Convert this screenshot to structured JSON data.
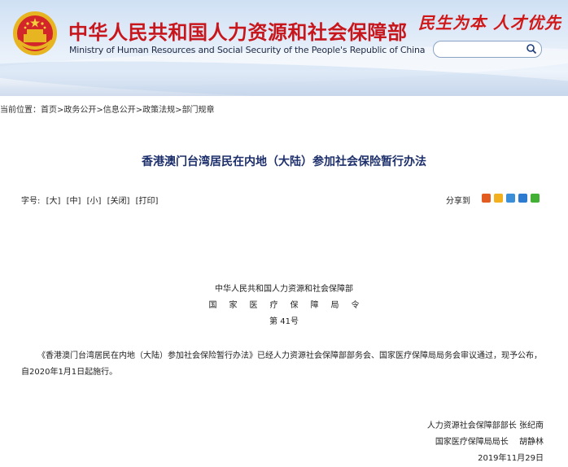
{
  "header": {
    "cn_title": "中华人民共和国人力资源和社会保障部",
    "en_title": "Ministry of Human Resources and Social Security of the People's Republic of China",
    "slogan": "民生为本 人才优先",
    "search_placeholder": "",
    "emblem_icon": "national-emblem-icon",
    "search_icon": "magnifier-icon",
    "brand_color": "#c8161d"
  },
  "breadcrumb": {
    "prefix": "当前位置：",
    "items": [
      "首页",
      "政务公开",
      "信息公开",
      "政策法规",
      "部门规章"
    ],
    "separator": ">"
  },
  "article": {
    "title": "香港澳门台湾居民在内地（大陆）参加社会保险暂行办法",
    "title_color": "#1d2f6b"
  },
  "toolbar": {
    "font_label": "字号:",
    "large": "[大]",
    "medium": "[中]",
    "small": "[小]",
    "close": "[关闭]",
    "print": "[打印]",
    "share_label": "分享到"
  },
  "issuer": {
    "line1": "中华人民共和国人力资源和社会保障部",
    "line2": "国家医疗保障局令",
    "line3": "第 41号"
  },
  "body": {
    "paragraph": "《香港澳门台湾居民在内地（大陆）参加社会保险暂行办法》已经人力资源社会保障部部务会、国家医疗保障局局务会审议通过，现予公布，自2020年1月1日起施行。"
  },
  "signatures": {
    "line1": "人力资源社会保障部部长 张纪南",
    "line2": "国家医疗保障局局长　 胡静林",
    "date": "2019年11月29日"
  },
  "share_icons": [
    {
      "name": "rss-icon",
      "color": "#e25b21"
    },
    {
      "name": "qzone-icon",
      "color": "#f2b01e"
    },
    {
      "name": "weibo-icon",
      "color": "#3a8fd8"
    },
    {
      "name": "renren-icon",
      "color": "#2d7bd0"
    },
    {
      "name": "wechat-icon",
      "color": "#41b035"
    }
  ]
}
